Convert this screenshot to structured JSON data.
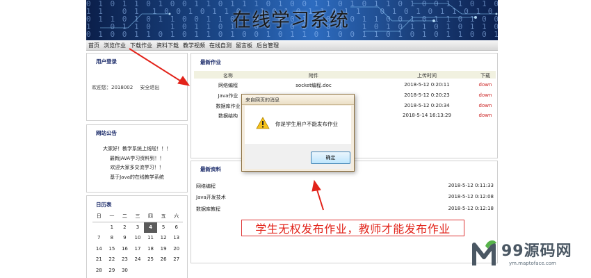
{
  "header": {
    "title": "在线学习系统"
  },
  "nav": {
    "items": [
      "首页",
      "浏览作业",
      "下载作业",
      "资料下载",
      "教学视频",
      "在线自测",
      "留言板",
      "后台管理"
    ]
  },
  "login": {
    "heading": "用户登录",
    "welcome": "欢迎您：2018002",
    "logout": "安全退出"
  },
  "notice": {
    "heading": "网站公告",
    "lines": [
      "大家好！教学系统上线啦！！！",
      "最新JAVA学习资料到！！",
      "欢迎大家多交流学习！！",
      "基于Java的在线教学系统"
    ]
  },
  "calendar": {
    "heading": "日历表",
    "weekdays": [
      "日",
      "一",
      "二",
      "三",
      "四",
      "五",
      "六"
    ],
    "weeks": [
      [
        "",
        "",
        "1",
        "2",
        "3",
        "4",
        "5",
        "6"
      ],
      [
        "7",
        "8",
        "9",
        "10",
        "11",
        "12",
        "13"
      ],
      [
        "14",
        "15",
        "16",
        "17",
        "18",
        "19",
        "20"
      ],
      [
        "21",
        "22",
        "23",
        "24",
        "25",
        "26",
        "27"
      ],
      [
        "28",
        "29",
        "30",
        "",
        "",
        "",
        ""
      ]
    ],
    "today": "4"
  },
  "homework": {
    "heading": "最新作业",
    "columns": {
      "name": "名称",
      "attachment": "附件",
      "time": "上传时间",
      "download": "下载"
    },
    "rows": [
      {
        "name": "网络编程",
        "attachment": "socket编程.doc",
        "time": "2018-5-12 0:20:11",
        "download": "down"
      },
      {
        "name": "Java作业",
        "attachment": "",
        "time": "2018-5-12 0:20:23",
        "download": "down"
      },
      {
        "name": "数据库作业",
        "attachment": "",
        "time": "2018-5-12 0:20:34",
        "download": "down"
      },
      {
        "name": "数据结构",
        "attachment": "",
        "time": "2018-5-14 16:13:29",
        "download": "down"
      }
    ]
  },
  "materials": {
    "heading": "最新资料",
    "rows": [
      {
        "name": "网络编程",
        "time": "2018-5-12 0:11:33"
      },
      {
        "name": "Java开发技术",
        "time": "2018-5-12 0:12:08"
      },
      {
        "name": "数据库教程",
        "time": "2018-5-12 0:12:18"
      }
    ]
  },
  "dialog": {
    "title": "来自网页的消息",
    "message": "你是学生用户不能发布作业",
    "ok_label": "确定"
  },
  "annotation": {
    "text": "学生无权发布作业，教师才能发布作业"
  },
  "watermark": {
    "brand": "99源码网",
    "url": "ym.maptoface.com"
  },
  "colors": {
    "heading": "#1b2b6a",
    "annotation_red": "#e2231a",
    "down_link": "#cc2222"
  }
}
